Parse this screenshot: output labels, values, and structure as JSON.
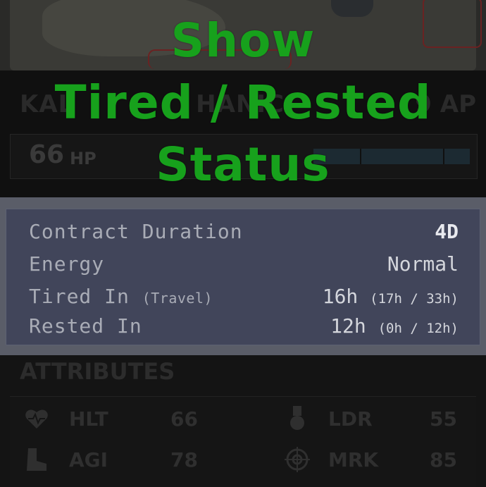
{
  "headline": {
    "line1": "Show",
    "line2": "Tired / Rested",
    "line3": "Status",
    "color": "#17a11c"
  },
  "background": {
    "name_partial_left": "KAL",
    "name_partial_mid": "HANIC",
    "ap_partial": "9 AP",
    "hp_value": "66",
    "hp_unit": "HP"
  },
  "panel": {
    "rows": [
      {
        "label": "Contract Duration",
        "sublabel": "",
        "value": "4D",
        "detail": ""
      },
      {
        "label": "Energy",
        "sublabel": "",
        "value": "Normal",
        "detail": ""
      },
      {
        "label": "Tired In",
        "sublabel": "(Travel)",
        "value": "16h",
        "detail": "(17h / 33h)"
      },
      {
        "label": "Rested In",
        "sublabel": "",
        "value": "12h",
        "detail": "(0h / 12h)"
      }
    ]
  },
  "attributes": {
    "title": "ATTRIBUTES",
    "items": [
      {
        "code": "HLT",
        "value": "66",
        "icon": "heart-icon"
      },
      {
        "code": "LDR",
        "value": "55",
        "icon": "medal-icon"
      },
      {
        "code": "AGI",
        "value": "78",
        "icon": "boot-icon"
      },
      {
        "code": "MRK",
        "value": "85",
        "icon": "crosshair-icon"
      }
    ]
  }
}
